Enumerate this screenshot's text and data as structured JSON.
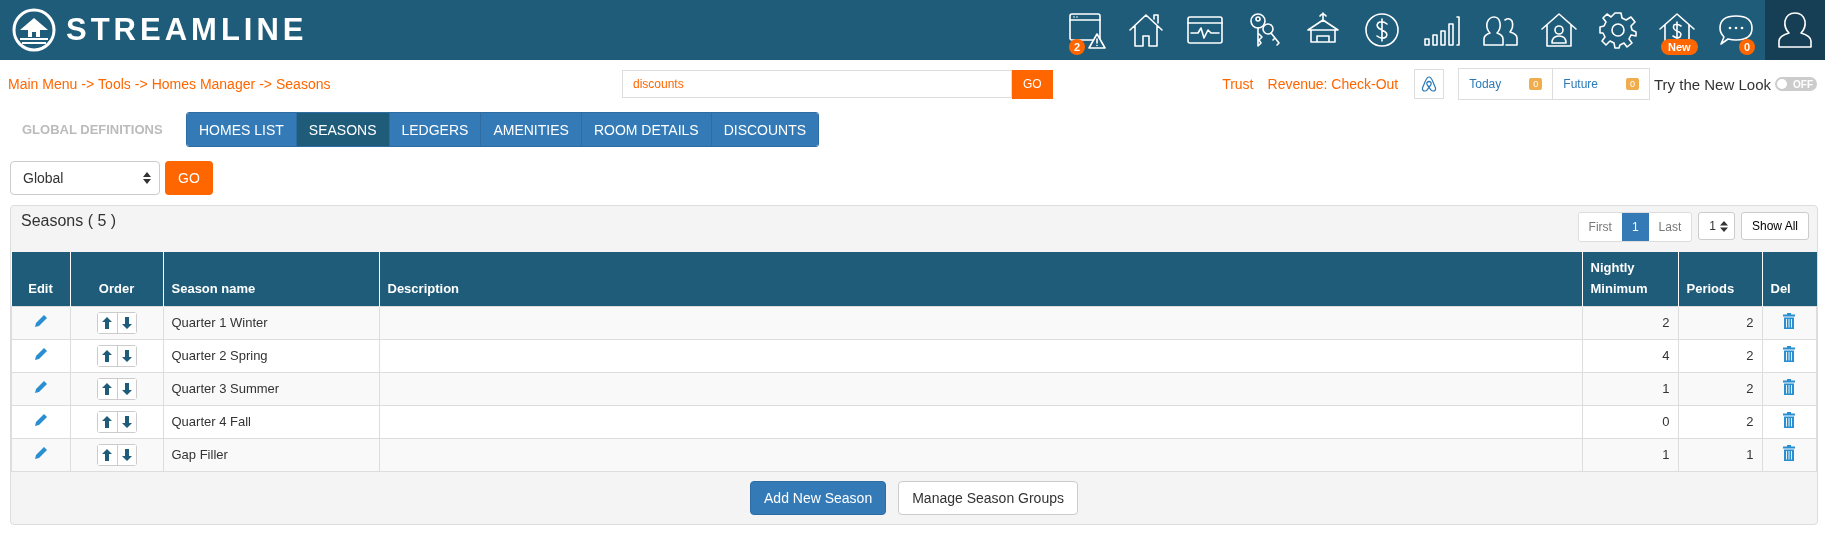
{
  "header": {
    "logo": "STREAMLINE",
    "nav_icons": [
      {
        "badge": "2",
        "selected": false
      },
      {
        "selected": false
      },
      {
        "selected": false
      },
      {
        "selected": false
      },
      {
        "selected": false
      },
      {
        "selected": false
      },
      {
        "selected": false
      },
      {
        "selected": false
      },
      {
        "selected": false
      },
      {
        "selected": false
      },
      {
        "badge": "New",
        "selected": false
      },
      {
        "badge": "0",
        "selected": false
      },
      {
        "selected": true
      }
    ]
  },
  "toolbar": {
    "breadcrumb": [
      "Main Menu",
      "Tools",
      "Homes Manager",
      "Seasons"
    ],
    "separator": "->",
    "search": {
      "value": "discounts",
      "button": "GO"
    },
    "links": [
      "Trust",
      "Revenue: Check-Out"
    ],
    "counters": [
      {
        "label": "Today",
        "count": "0"
      },
      {
        "label": "Future",
        "count": "0"
      }
    ],
    "new_look": {
      "label": "Try the New Look",
      "on": false,
      "toggle_text": "OFF"
    }
  },
  "tabs": {
    "section_label": "GLOBAL DEFINITIONS",
    "items": [
      {
        "label": "HOMES LIST",
        "selected": false
      },
      {
        "label": "SEASONS",
        "selected": true
      },
      {
        "label": "LEDGERS",
        "selected": false
      },
      {
        "label": "AMENITIES",
        "selected": false
      },
      {
        "label": "ROOM DETAILS",
        "selected": false
      },
      {
        "label": "DISCOUNTS",
        "selected": false
      }
    ]
  },
  "filter": {
    "select": "Global",
    "button": "GO"
  },
  "panel": {
    "title": "Seasons ( 5 )",
    "pagination": [
      {
        "label": "First",
        "selected": false
      },
      {
        "label": "1",
        "selected": true
      },
      {
        "label": "Last",
        "selected": false
      }
    ],
    "page_select": "1",
    "show_all": "Show All",
    "table": {
      "columns": [
        "Edit",
        "Order",
        "Season name",
        "Description",
        "Nightly Minimum",
        "Periods",
        "Del"
      ],
      "rows": [
        {
          "season_name": "Quarter 1 Winter",
          "nightly_minimum": "2",
          "periods": "2"
        },
        {
          "season_name": "Quarter 2 Spring",
          "nightly_minimum": "4",
          "periods": "2"
        },
        {
          "season_name": "Quarter 3 Summer",
          "nightly_minimum": "1",
          "periods": "2"
        },
        {
          "season_name": "Quarter 4 Fall",
          "nightly_minimum": "0",
          "periods": "2"
        },
        {
          "season_name": "Gap Filler",
          "nightly_minimum": "1",
          "periods": "1"
        }
      ]
    },
    "buttons": [
      {
        "label": "Add New Season",
        "kind": "primary"
      },
      {
        "label": "Manage Season Groups",
        "kind": "default"
      }
    ]
  }
}
